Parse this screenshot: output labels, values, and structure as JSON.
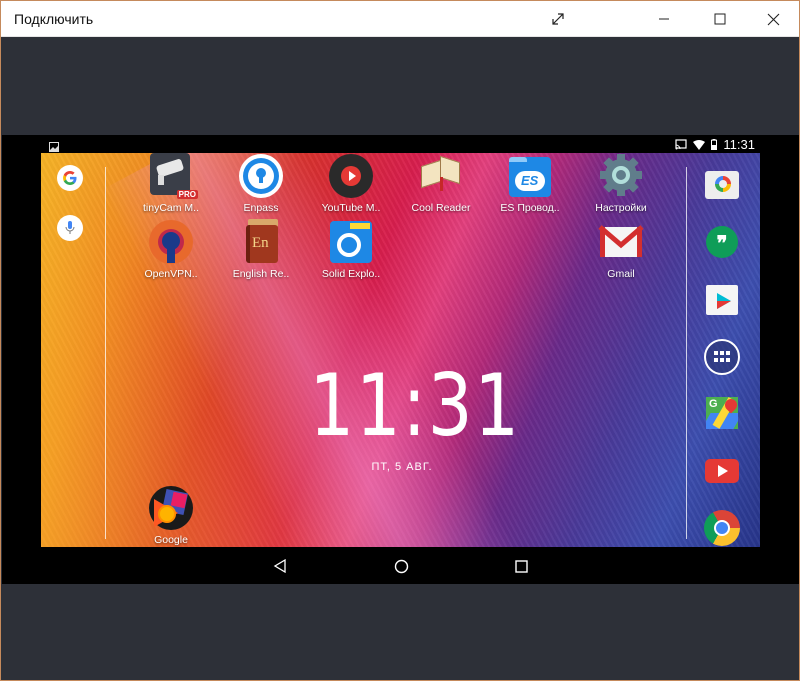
{
  "window": {
    "title": "Подключить",
    "buttons": {
      "fullscreen": "expand-icon",
      "minimize": "minimize-icon",
      "maximize": "maximize-icon",
      "close": "close-icon"
    }
  },
  "status_bar": {
    "left_icon": "screenshot-notification-icon",
    "right_icons": [
      "cast-icon",
      "wifi-icon",
      "battery-icon"
    ],
    "time": "11:31"
  },
  "left_dock": [
    {
      "name": "google-search",
      "glyph": "G"
    },
    {
      "name": "voice-search",
      "glyph": "mic"
    }
  ],
  "apps": [
    {
      "label": "tinyCam M..",
      "icon": "tinycam-icon",
      "badge": "PRO"
    },
    {
      "label": "Enpass",
      "icon": "enpass-icon"
    },
    {
      "label": "YouTube M..",
      "icon": "youtube-music-icon"
    },
    {
      "label": "Cool Reader",
      "icon": "cool-reader-icon"
    },
    {
      "label": "ES Провод..",
      "icon": "es-explorer-icon",
      "glyph": "ES"
    },
    {
      "label": "Настройки",
      "icon": "settings-icon"
    },
    {
      "label": "OpenVPN..",
      "icon": "openvpn-icon"
    },
    {
      "label": "English Re..",
      "icon": "english-reader-icon",
      "glyph": "En"
    },
    {
      "label": "Solid Explo..",
      "icon": "solid-explorer-icon"
    },
    {
      "label": "Gmail",
      "icon": "gmail-icon"
    },
    {
      "label": "Google",
      "icon": "google-play-music-icon"
    }
  ],
  "right_dock": [
    {
      "name": "camera-icon"
    },
    {
      "name": "hangouts-icon",
      "glyph": "❞"
    },
    {
      "name": "play-store-icon"
    },
    {
      "name": "app-drawer-icon"
    },
    {
      "name": "maps-icon",
      "glyph": "G"
    },
    {
      "name": "youtube-icon"
    },
    {
      "name": "chrome-icon"
    }
  ],
  "clock": {
    "time": "11:31",
    "date": "ПТ, 5 АВГ."
  },
  "nav_bar": {
    "back": "back-icon",
    "home": "home-icon",
    "recents": "recents-icon"
  },
  "colors": {
    "window_bg": "#2d3038",
    "titlebar_bg": "#ffffff",
    "phone_frame": "#000000"
  }
}
